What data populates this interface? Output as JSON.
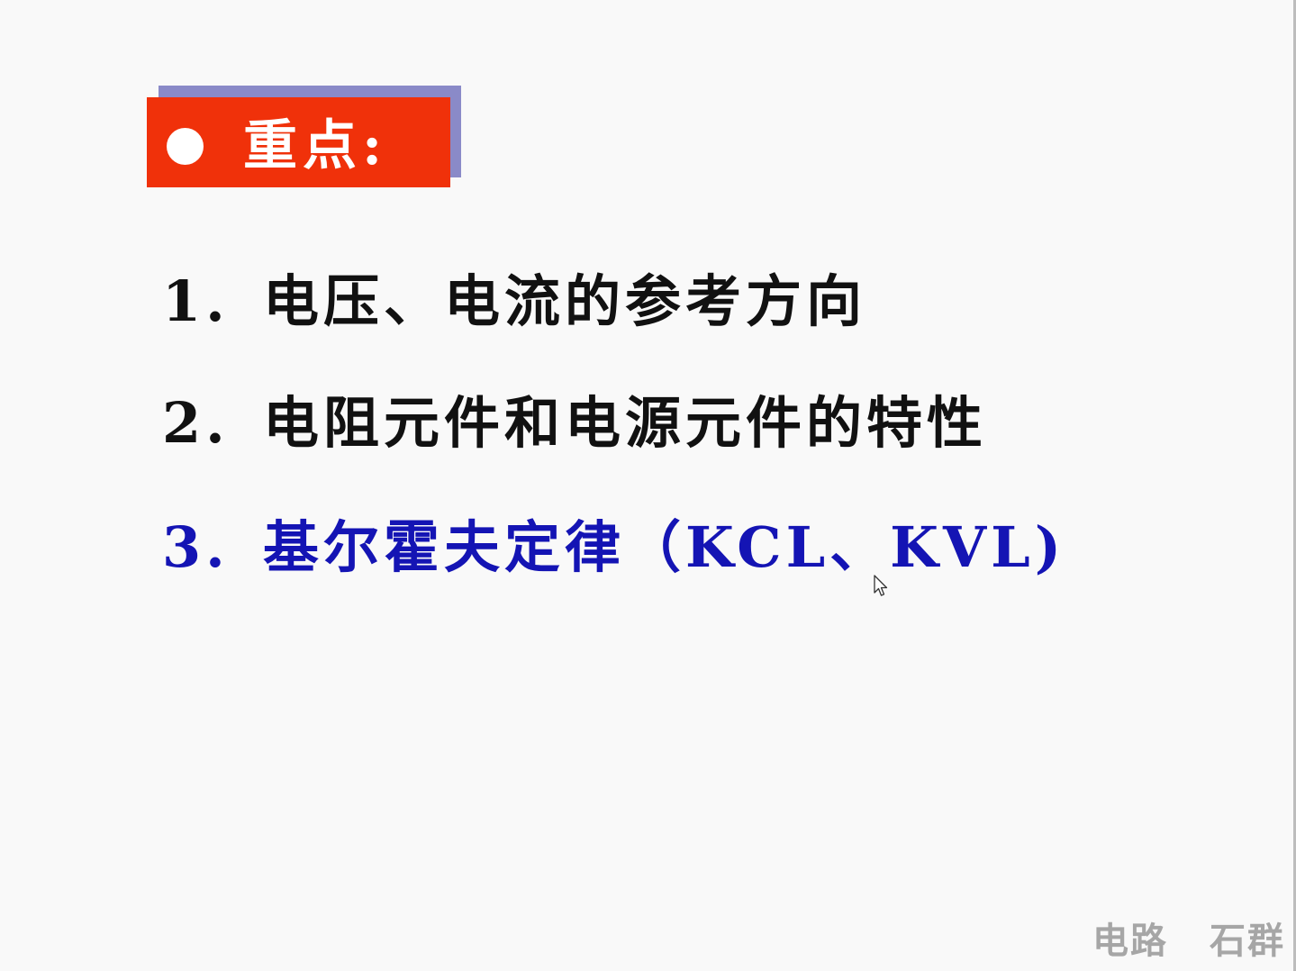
{
  "slide": {
    "heading": "重点:",
    "points": [
      {
        "number": "1.",
        "text": "电压、电流的参考方向"
      },
      {
        "number": "2.",
        "text": "电阻元件和电源元件的特性"
      },
      {
        "number": "3.",
        "text": "基尔霍夫定律（KCL、KVL)"
      }
    ],
    "footer": {
      "course": "电路",
      "author": "石群"
    }
  },
  "colors": {
    "heading_bg": "#f0310a",
    "heading_shadow": "#8a8ac8",
    "point_text": "#111111",
    "highlight_text": "#1414b4",
    "footer_text": "#a6a6a6"
  },
  "icons": {
    "bullet": "circle-bullet-icon",
    "cursor": "mouse-pointer-icon"
  }
}
